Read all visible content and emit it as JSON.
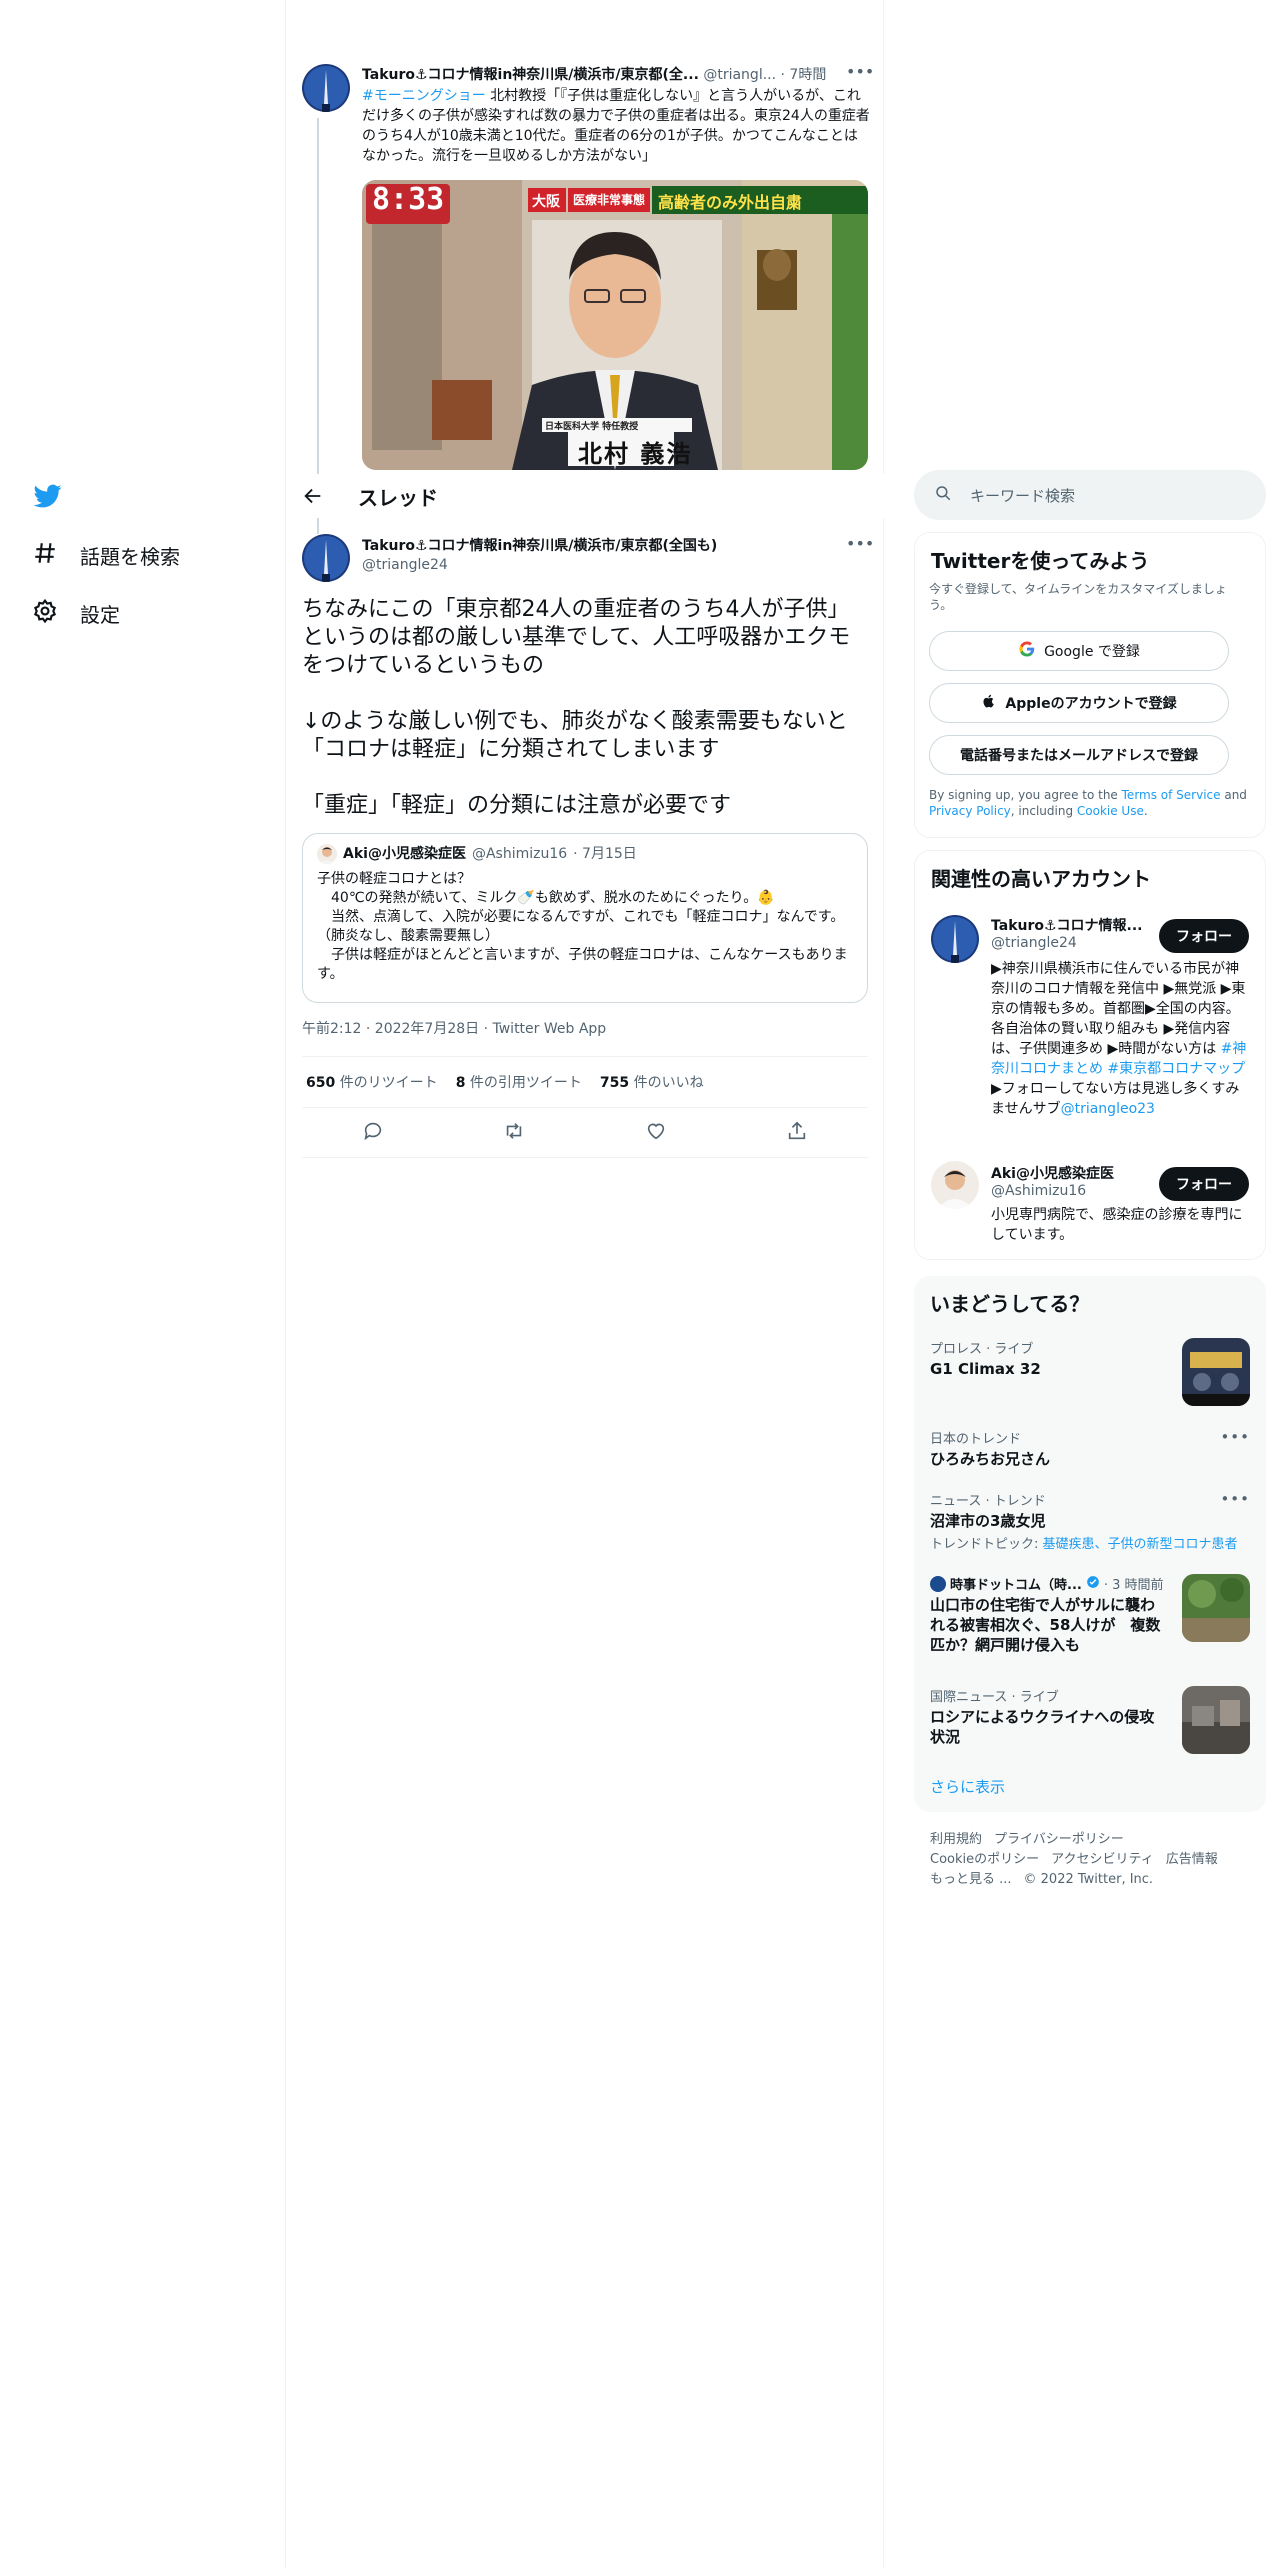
{
  "nav": {
    "explore_label": "話題を検索",
    "settings_label": "設定"
  },
  "parent_tweet": {
    "author_name": "Takuro⚓コロナ情報in神奈川県/横浜市/東京都(全...",
    "handle": "@triangl...",
    "time": "· 7時間",
    "hashtag": "#モーニングショー",
    "text": " 北村教授「『子供は重症化しない』と言う人がいるが、これだけ多くの子供が感染すれば数の暴力で子供の重症者は出る。東京24人の重症者のうち4人が10歳未満と10代だ。重症者の6分の1が子供。かつてこんなことはなかった。流行を一旦収めるしか方法がない」",
    "image": {
      "clock": "8:33",
      "badge_osaka": "大阪",
      "badge_emergency": "医療非常事態",
      "headline": "高齢者のみ外出自粛",
      "affiliation": "日本医科大学 特任教授",
      "person_name": "北村 義浩"
    }
  },
  "header": {
    "title": "スレッド"
  },
  "main_tweet": {
    "author_name": "Takuro⚓コロナ情報in神奈川県/横浜市/東京都(全国も)",
    "handle": "@triangle24",
    "paragraph1": "ちなみにこの「東京都24人の重症者のうち4人が子供」というのは都の厳しい基準でして、人工呼吸器かエクモをつけているというもの",
    "paragraph2": "↓のような厳しい例でも、肺炎がなく酸素需要もないと「コロナは軽症」に分類されてしまいます",
    "paragraph3": "「重症」「軽症」の分類には注意が必要です",
    "timestamp": "午前2:12 · 2022年7月28日 · Twitter Web App"
  },
  "quoted_tweet": {
    "author_name": "Aki@小児感染症医",
    "handle": "@Ashimizu16",
    "date": "· 7月15日",
    "line1": "子供の軽症コロナとは？",
    "line2": "　40℃の発熱が続いて、ミルク🍼も飲めず、脱水のためにぐったり。👶",
    "line3": "　当然、点滴して、入院が必要になるんですが、これでも「軽症コロナ」なんです。（肺炎なし、酸素需要無し）",
    "line4": "　子供は軽症がほとんどと言いますが、子供の軽症コロナは、こんなケースもあります。"
  },
  "stats": {
    "retweets_count": "650",
    "retweets_label": "件のリツイート",
    "quotes_count": "8",
    "quotes_label": "件の引用ツイート",
    "likes_count": "755",
    "likes_label": "件のいいね"
  },
  "search": {
    "placeholder": "キーワード検索"
  },
  "signup": {
    "title": "Twitterを使ってみよう",
    "subtitle": "今すぐ登録して、タイムラインをカスタマイズしましょう。",
    "google_label": "Google で登録",
    "apple_label": "Appleのアカウントで登録",
    "phone_label": "電話番号またはメールアドレスで登録",
    "terms_prefix": "By signing up, you agree to the ",
    "terms_link": "Terms of Service",
    "terms_and": " and ",
    "privacy_link": "Privacy Policy",
    "terms_including": ", including ",
    "cookie_link": "Cookie Use",
    "terms_end": "."
  },
  "relevant": {
    "title": "関連性の高いアカウント",
    "follow_label": "フォロー",
    "accounts": [
      {
        "name": "Takuro⚓コロナ情報...",
        "handle": "@triangle24",
        "bio": "▶神奈川県横浜市に住んでいる市民が神奈川のコロナ情報を発信中 ▶無党派 ▶東京の情報も多め。首都圏▶全国の内容。各自治体の賢い取り組みも ▶発信内容は、子供関連多め ▶時間がない方は ",
        "bio_tags": "#神奈川コロナまとめ #東京都コロナマップ",
        "bio_end": " ▶フォローしてない方は見逃し多くすみませんサブ",
        "bio_link": "@triangleo23"
      },
      {
        "name": "Aki@小児感染症医",
        "handle": "@Ashimizu16",
        "bio": "小児専門病院で、感染症の診療を専門にしています。"
      }
    ]
  },
  "trends": {
    "title": "いまどうしてる？",
    "items": [
      {
        "category": "プロレス · ライブ",
        "title": "G1 Climax 32"
      },
      {
        "category": "日本のトレンド",
        "title": "ひろみちお兄さん"
      },
      {
        "category": "ニュース · トレンド",
        "title": "沼津市の3歳女児",
        "topics_label": "トレンドトピック: ",
        "topics": "基礎疾患、子供の新型コロナ患者"
      },
      {
        "source": "時事ドットコム（時...",
        "time": "· 3 時間前",
        "title": "山口市の住宅街で人がサルに襲われる被害相次ぐ、58人けが　複数匹か？網戸開け侵入も"
      },
      {
        "category": "国際ニュース · ライブ",
        "title": "ロシアによるウクライナへの侵攻状況"
      }
    ],
    "show_more": "さらに表示"
  },
  "footer": {
    "terms": "利用規約",
    "privacy": "プライバシーポリシー",
    "cookie": "Cookieのポリシー",
    "accessibility": "アクセシビリティ",
    "ads": "広告情報",
    "more": "もっと見る ...",
    "copyright": "© 2022 Twitter, Inc."
  },
  "colors": {
    "accent": "#1d9bf0",
    "text": "#0f1419",
    "muted": "#536471",
    "border": "#eff3f4"
  }
}
